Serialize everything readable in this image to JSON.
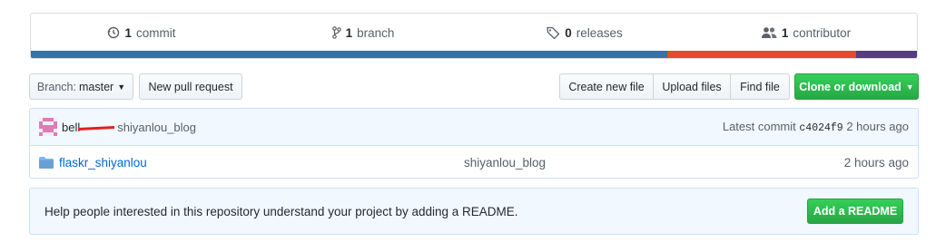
{
  "summary": {
    "commits": {
      "count": "1",
      "label": "commit"
    },
    "branches": {
      "count": "1",
      "label": "branch"
    },
    "releases": {
      "count": "0",
      "label": "releases"
    },
    "contributors": {
      "count": "1",
      "label": "contributor"
    }
  },
  "language_bar": [
    {
      "color": "#3572a5",
      "share": 0.718
    },
    {
      "color": "#e34c26",
      "share": 0.213
    },
    {
      "color": "#563d7c",
      "share": 0.069
    }
  ],
  "toolbar": {
    "branch_prefix": "Branch:",
    "branch_name": "master",
    "new_pull_request": "New pull request",
    "create_new_file": "Create new file",
    "upload_files": "Upload files",
    "find_file": "Find file",
    "clone_or_download": "Clone or download"
  },
  "latest_commit": {
    "author": "bell",
    "message": "shiyanlou_blog",
    "prefix": "Latest commit",
    "sha": "c4024f9",
    "age": "2 hours ago"
  },
  "files": [
    {
      "name": "flaskr_shiyanlou",
      "message": "shiyanlou_blog",
      "age": "2 hours ago",
      "icon": "folder-icon"
    }
  ],
  "readme": {
    "text": "Help people interested in this repository understand your project by adding a README.",
    "button": "Add a README"
  },
  "colors": {
    "link": "#0366d6",
    "primary_green": "#28a745",
    "info_bg": "#f1f8ff"
  }
}
